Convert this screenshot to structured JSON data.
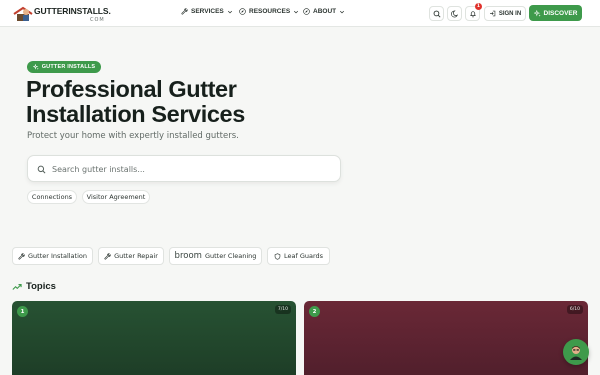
{
  "brand": {
    "name": "GUTTERINSTALLS.",
    "tld": "COM"
  },
  "nav": {
    "services": "SERVICES",
    "resources": "RESOURCES",
    "about": "ABOUT"
  },
  "header_actions": {
    "notification_count": "1",
    "sign_in": "SIGN IN",
    "discover": "DISCOVER"
  },
  "hero": {
    "badge": "GUTTER INSTALLS",
    "title": "Professional Gutter Installation Services",
    "subtitle": "Protect your home with expertly installed gutters."
  },
  "search": {
    "placeholder": "Search gutter installs..."
  },
  "chips": [
    "Connections",
    "Visitor Agreement"
  ],
  "categories": [
    {
      "label": "Gutter Installation",
      "icon": "wrench-icon"
    },
    {
      "label": "Gutter Repair",
      "icon": "wrench-icon"
    },
    {
      "label": "Gutter Cleaning",
      "icon": "broom-word",
      "icon_text": "broom"
    },
    {
      "label": "Leaf Guards",
      "icon": "shield-icon"
    }
  ],
  "topics": {
    "heading": "Topics",
    "cards": [
      {
        "number": "1",
        "count": "7/10",
        "color": "#275233"
      },
      {
        "number": "2",
        "count": "6/10",
        "color": "#6a2836"
      }
    ]
  },
  "colors": {
    "accent": "#3e9a4b",
    "badge_red": "#e0322c"
  }
}
